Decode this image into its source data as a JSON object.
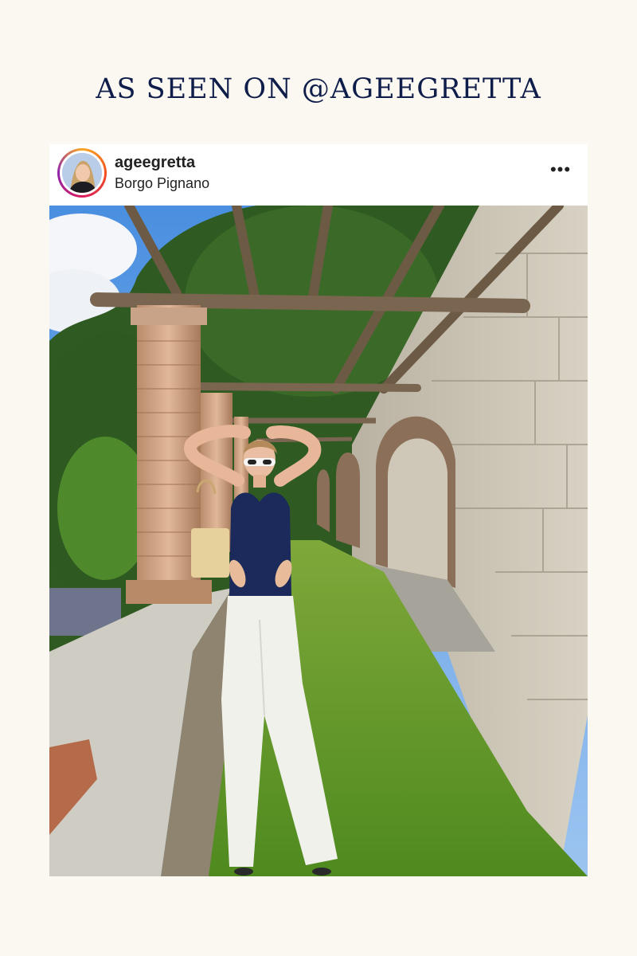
{
  "headline": "AS SEEN ON @AGEEGRETTA",
  "post": {
    "username": "ageegretta",
    "location": "Borgo Pignano",
    "more_icon": "•••"
  },
  "colors": {
    "background": "#fbf8f1",
    "headline": "#0f1d4a",
    "story_ring": [
      "#f9a825",
      "#d81b60",
      "#8e24aa"
    ]
  }
}
